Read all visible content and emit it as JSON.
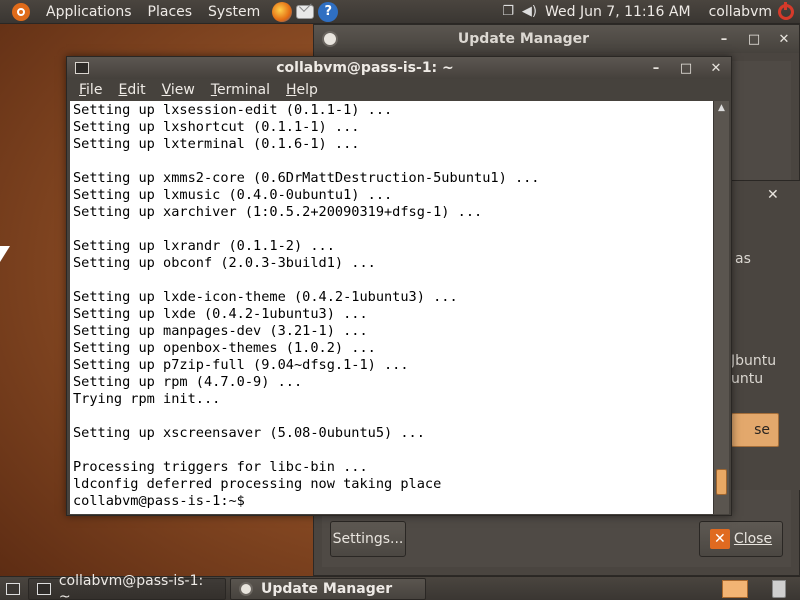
{
  "top_panel": {
    "menus": [
      "Applications",
      "Places",
      "System"
    ],
    "clock": "Wed Jun  7, 11:16 AM",
    "user": "collabvm"
  },
  "update_manager": {
    "title": "Update Manager",
    "settings_label": "Settings...",
    "close_label": "Close"
  },
  "dialog": {
    "fragments": [
      "as",
      "Jbuntu",
      "untu"
    ],
    "button_fragment": "se"
  },
  "terminal": {
    "title": "collabvm@pass-is-1: ~",
    "menus": [
      "File",
      "Edit",
      "View",
      "Terminal",
      "Help"
    ],
    "lines": [
      "Setting up lxsession-edit (0.1.1-1) ...",
      "Setting up lxshortcut (0.1.1-1) ...",
      "Setting up lxterminal (0.1.6-1) ...",
      "",
      "Setting up xmms2-core (0.6DrMattDestruction-5ubuntu1) ...",
      "Setting up lxmusic (0.4.0-0ubuntu1) ...",
      "Setting up xarchiver (1:0.5.2+20090319+dfsg-1) ...",
      "",
      "Setting up lxrandr (0.1.1-2) ...",
      "Setting up obconf (2.0.3-3build1) ...",
      "",
      "Setting up lxde-icon-theme (0.4.2-1ubuntu3) ...",
      "Setting up lxde (0.4.2-1ubuntu3) ...",
      "Setting up manpages-dev (3.21-1) ...",
      "Setting up openbox-themes (1.0.2) ...",
      "Setting up p7zip-full (9.04~dfsg.1-1) ...",
      "Setting up rpm (4.7.0-9) ...",
      "Trying rpm init...",
      "",
      "Setting up xscreensaver (5.08-0ubuntu5) ...",
      "",
      "Processing triggers for libc-bin ...",
      "ldconfig deferred processing now taking place",
      "collabvm@pass-is-1:~$ "
    ]
  },
  "taskbar": {
    "tasks": [
      "collabvm@pass-is-1: ~",
      "Update Manager"
    ]
  },
  "colors": {
    "accent": "#e06a20",
    "panel": "#3f3b37",
    "terminal_bg": "#ffffff"
  }
}
